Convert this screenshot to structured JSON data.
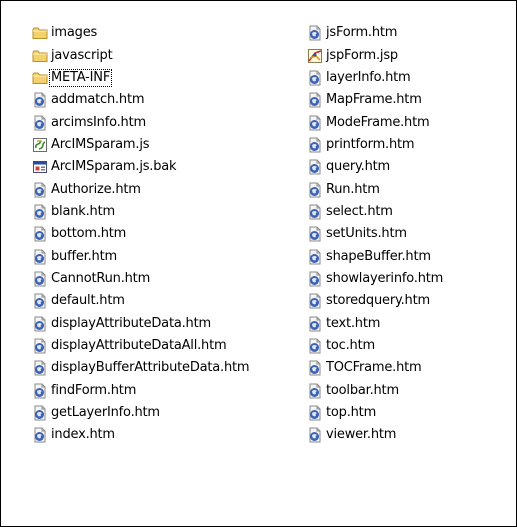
{
  "left_column": [
    {
      "name": "images",
      "type": "folder"
    },
    {
      "name": "javascript",
      "type": "folder"
    },
    {
      "name": "META-INF",
      "type": "folder",
      "focused": true
    },
    {
      "name": "addmatch.htm",
      "type": "htm"
    },
    {
      "name": "arcimsInfo.htm",
      "type": "htm"
    },
    {
      "name": "ArcIMSparam.js",
      "type": "js"
    },
    {
      "name": "ArcIMSparam.js.bak",
      "type": "bak"
    },
    {
      "name": "Authorize.htm",
      "type": "htm"
    },
    {
      "name": "blank.htm",
      "type": "htm"
    },
    {
      "name": "bottom.htm",
      "type": "htm"
    },
    {
      "name": "buffer.htm",
      "type": "htm"
    },
    {
      "name": "CannotRun.htm",
      "type": "htm"
    },
    {
      "name": "default.htm",
      "type": "htm"
    },
    {
      "name": "displayAttributeData.htm",
      "type": "htm"
    },
    {
      "name": "displayAttributeDataAll.htm",
      "type": "htm"
    },
    {
      "name": "displayBufferAttributeData.htm",
      "type": "htm"
    },
    {
      "name": "findForm.htm",
      "type": "htm"
    },
    {
      "name": "getLayerInfo.htm",
      "type": "htm"
    },
    {
      "name": "index.htm",
      "type": "htm"
    }
  ],
  "right_column": [
    {
      "name": "jsForm.htm",
      "type": "htm"
    },
    {
      "name": "jspForm.jsp",
      "type": "jsp"
    },
    {
      "name": "layerInfo.htm",
      "type": "htm"
    },
    {
      "name": "MapFrame.htm",
      "type": "htm"
    },
    {
      "name": "ModeFrame.htm",
      "type": "htm"
    },
    {
      "name": "printform.htm",
      "type": "htm"
    },
    {
      "name": "query.htm",
      "type": "htm"
    },
    {
      "name": "Run.htm",
      "type": "htm"
    },
    {
      "name": "select.htm",
      "type": "htm"
    },
    {
      "name": "setUnits.htm",
      "type": "htm"
    },
    {
      "name": "shapeBuffer.htm",
      "type": "htm"
    },
    {
      "name": "showlayerinfo.htm",
      "type": "htm"
    },
    {
      "name": "storedquery.htm",
      "type": "htm"
    },
    {
      "name": "text.htm",
      "type": "htm"
    },
    {
      "name": "toc.htm",
      "type": "htm"
    },
    {
      "name": "TOCFrame.htm",
      "type": "htm"
    },
    {
      "name": "toolbar.htm",
      "type": "htm"
    },
    {
      "name": "top.htm",
      "type": "htm"
    },
    {
      "name": "viewer.htm",
      "type": "htm"
    }
  ],
  "icons": {
    "folder": "folder-icon",
    "htm": "html-document-icon",
    "js": "script-file-icon",
    "bak": "backup-file-icon",
    "jsp": "jsp-file-icon"
  },
  "colors": {
    "folder_fill": "#f4d26b",
    "folder_stroke": "#b8912a",
    "htm_blue": "#3a62b5",
    "background": "#ffffff",
    "text": "#000000"
  }
}
